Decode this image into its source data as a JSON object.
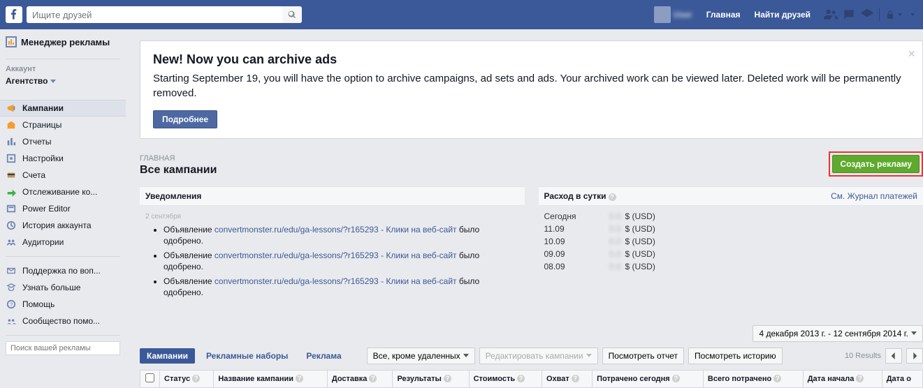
{
  "topbar": {
    "search_placeholder": "Ищите друзей",
    "home": "Главная",
    "find_friends": "Найти друзей"
  },
  "sidebar": {
    "manager_title": "Менеджер рекламы",
    "account_label": "Аккаунт",
    "account_name": "Агентство",
    "nav": [
      {
        "label": "Кампании"
      },
      {
        "label": "Страницы"
      },
      {
        "label": "Отчеты"
      },
      {
        "label": "Настройки"
      },
      {
        "label": "Счета"
      },
      {
        "label": "Отслеживание ко..."
      },
      {
        "label": "Power Editor"
      },
      {
        "label": "История аккаунта"
      },
      {
        "label": "Аудитории"
      }
    ],
    "help": [
      {
        "label": "Поддержка по воп..."
      },
      {
        "label": "Узнать больше"
      },
      {
        "label": "Помощь"
      },
      {
        "label": "Сообщество помо..."
      }
    ],
    "search_placeholder": "Поиск вашей рекламы"
  },
  "notice": {
    "title": "New! Now you can archive ads",
    "body": "Starting September 19, you will have the option to archive campaigns, ad sets and ads. Your archived work can be viewed later. Deleted work will be permanently removed.",
    "button": "Подробнее"
  },
  "breadcrumb": {
    "crumb": "ГЛАВНАЯ",
    "title": "Все кампании",
    "create_btn": "Создать рекламу"
  },
  "notifications": {
    "heading": "Уведомления",
    "date": "2 сентября",
    "items": [
      {
        "prefix": "Объявление ",
        "link": "convertmonster.ru/edu/ga-lessons/?r165293 - Клики на веб-сайт",
        "suffix": " было одобрено."
      },
      {
        "prefix": "Объявление ",
        "link": "convertmonster.ru/edu/ga-lessons/?r165293 - Клики на веб-сайт",
        "suffix": " было одобрено."
      },
      {
        "prefix": "Объявление ",
        "link": "convertmonster.ru/edu/ga-lessons/?r165293 - Клики на веб-сайт",
        "suffix": " было одобрено."
      }
    ]
  },
  "spend": {
    "heading": "Расход в сутки",
    "billing_link": "См. Журнал платежей",
    "rows": [
      {
        "date": "Сегодня",
        "currency": "$ (USD)"
      },
      {
        "date": "11.09",
        "currency": "$ (USD)"
      },
      {
        "date": "10.09",
        "currency": "$ (USD)"
      },
      {
        "date": "09.09",
        "currency": "$ (USD)"
      },
      {
        "date": "08.09",
        "currency": "$ (USD)"
      }
    ]
  },
  "controls": {
    "date_range": "4 декабря 2013 г. - 12 сентября 2014 г.",
    "tabs": [
      {
        "label": "Кампании"
      },
      {
        "label": "Рекламные наборы"
      },
      {
        "label": "Реклама"
      }
    ],
    "filter": "Все, кроме удаленных",
    "edit": "Редактировать кампании",
    "view_report": "Посмотреть отчет",
    "view_history": "Посмотреть историю",
    "results": "10 Results"
  },
  "table": {
    "cols": [
      "Статус",
      "Название кампании",
      "Доставка",
      "Результаты",
      "Стоимость",
      "Охват",
      "Потрачено сегодня",
      "Всего потрачено",
      "Дата начала",
      "Дата о"
    ]
  }
}
